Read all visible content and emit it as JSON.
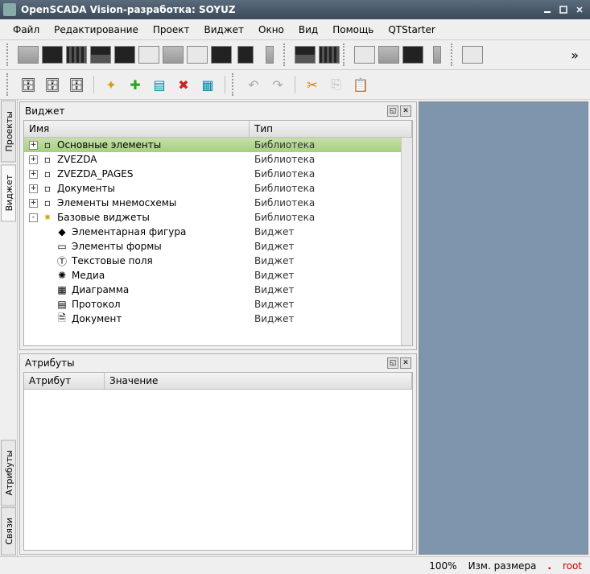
{
  "window": {
    "title": "OpenSCADA Vision-разработка: SOYUZ"
  },
  "menu": {
    "file": "Файл",
    "edit": "Редактирование",
    "project": "Проект",
    "widget": "Виджет",
    "window": "Окно",
    "view": "Вид",
    "help": "Помощь",
    "qtstarter": "QTStarter"
  },
  "side_tabs": {
    "projects": "Проекты",
    "widgets": "Виджет",
    "attributes": "Атрибуты",
    "links": "Связи"
  },
  "widget_panel": {
    "title": "Виджет",
    "col_name": "Имя",
    "col_type": "Тип",
    "rows": [
      {
        "indent": 0,
        "expander": "+",
        "icon": "lib",
        "name": "Основные элементы",
        "type": "Библиотека",
        "selected": true
      },
      {
        "indent": 0,
        "expander": "+",
        "icon": "lib",
        "name": "ZVEZDA",
        "type": "Библиотека"
      },
      {
        "indent": 0,
        "expander": "+",
        "icon": "lib",
        "name": "ZVEZDA_PAGES",
        "type": "Библиотека"
      },
      {
        "indent": 0,
        "expander": "+",
        "icon": "lib",
        "name": "Документы",
        "type": "Библиотека"
      },
      {
        "indent": 0,
        "expander": "+",
        "icon": "lib",
        "name": "Элементы мнемосхемы",
        "type": "Библиотека"
      },
      {
        "indent": 0,
        "expander": "-",
        "icon": "gear",
        "name": "Базовые виджеты",
        "type": "Библиотека"
      },
      {
        "indent": 1,
        "expander": "",
        "icon": "shape",
        "name": "Элементарная фигура",
        "type": "Виджет"
      },
      {
        "indent": 1,
        "expander": "",
        "icon": "form",
        "name": "Элементы формы",
        "type": "Виджет"
      },
      {
        "indent": 1,
        "expander": "",
        "icon": "text",
        "name": "Текстовые поля",
        "type": "Виджет"
      },
      {
        "indent": 1,
        "expander": "",
        "icon": "media",
        "name": "Медиа",
        "type": "Виджет"
      },
      {
        "indent": 1,
        "expander": "",
        "icon": "diagram",
        "name": "Диаграмма",
        "type": "Виджет"
      },
      {
        "indent": 1,
        "expander": "",
        "icon": "protocol",
        "name": "Протокол",
        "type": "Виджет"
      },
      {
        "indent": 1,
        "expander": "",
        "icon": "document",
        "name": "Документ",
        "type": "Виджет"
      }
    ]
  },
  "attr_panel": {
    "title": "Атрибуты",
    "col_attr": "Атрибут",
    "col_value": "Значение"
  },
  "status": {
    "zoom": "100%",
    "mode": "Изм. размера",
    "user": "root"
  }
}
